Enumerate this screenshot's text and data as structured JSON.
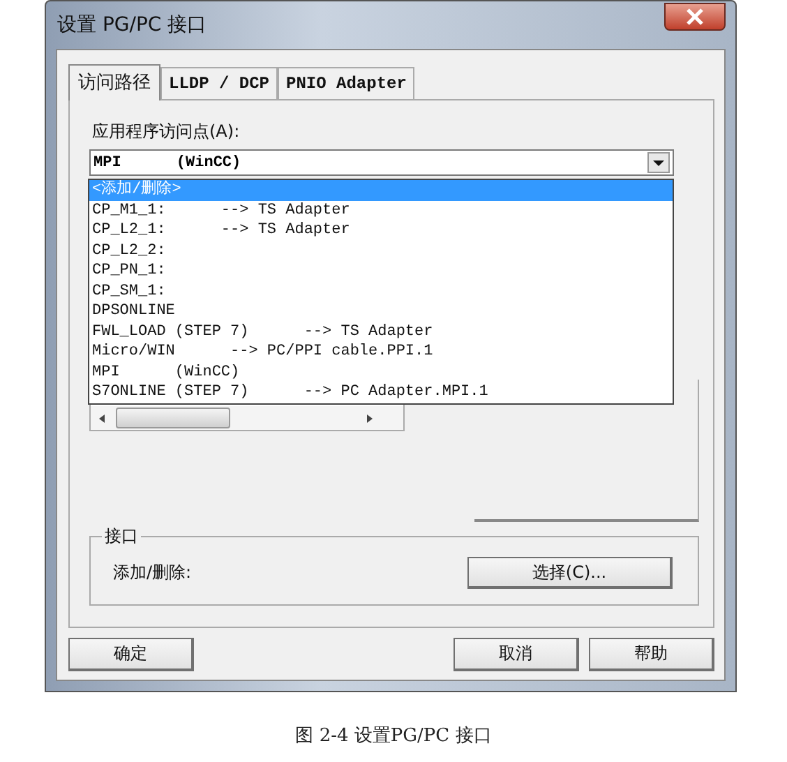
{
  "window": {
    "title": "设置 PG/PC 接口"
  },
  "tabs": [
    {
      "label": "访问路径",
      "selected": true
    },
    {
      "label": "LLDP / DCP",
      "selected": false
    },
    {
      "label": "PNIO Adapter",
      "selected": false
    }
  ],
  "access_point": {
    "label": "应用程序访问点(A):",
    "value": "MPI      (WinCC)"
  },
  "dropdown": [
    {
      "label": "<添加/删除>",
      "selected": true
    },
    {
      "label": "CP_M1_1:      --> TS Adapter",
      "selected": false
    },
    {
      "label": "CP_L2_1:      --> TS Adapter",
      "selected": false
    },
    {
      "label": "CP_L2_2:",
      "selected": false
    },
    {
      "label": "CP_PN_1:",
      "selected": false
    },
    {
      "label": "CP_SM_1:",
      "selected": false
    },
    {
      "label": "DPSONLINE",
      "selected": false
    },
    {
      "label": "FWL_LOAD (STEP 7)      --> TS Adapter",
      "selected": false
    },
    {
      "label": "Micro/WIN      --> PC/PPI cable.PPI.1",
      "selected": false
    },
    {
      "label": "MPI      (WinCC)",
      "selected": false
    },
    {
      "label": "S7ONLINE (STEP 7)      --> PC Adapter.MPI.1",
      "selected": false
    }
  ],
  "interface": {
    "title": "接口",
    "label": "添加/删除:",
    "button": "选择(C)..."
  },
  "buttons": [
    {
      "label": "确定"
    },
    {
      "label": "取消"
    },
    {
      "label": "帮助"
    }
  ],
  "caption": "图 2-4 设置PG/PC 接口"
}
